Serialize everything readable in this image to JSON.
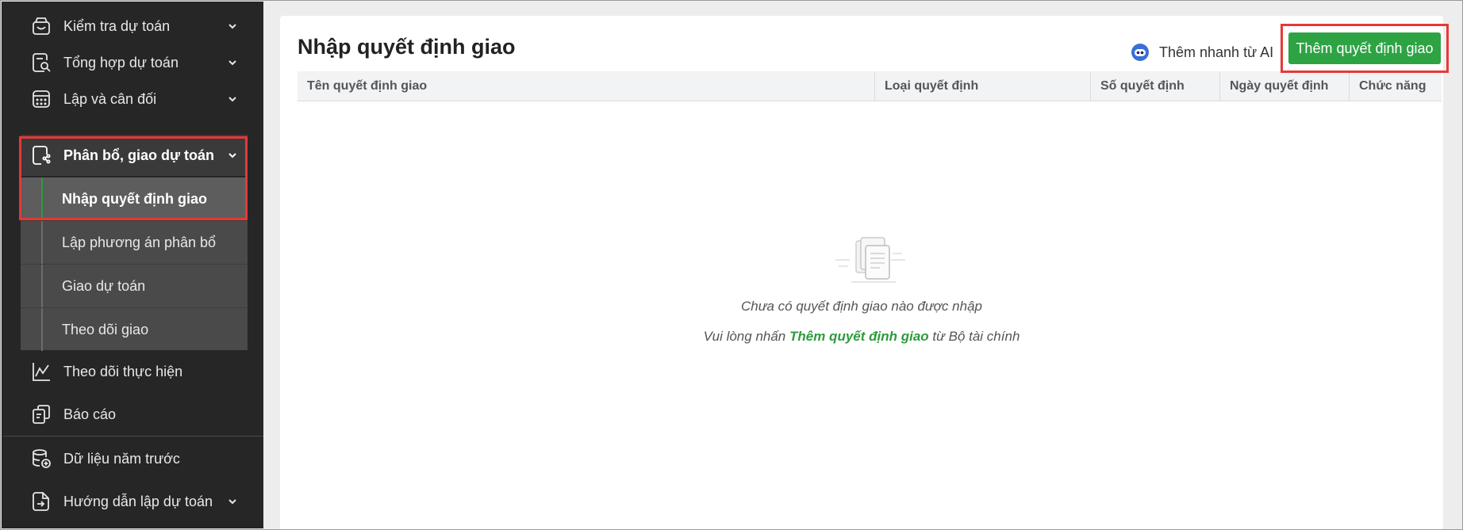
{
  "sidebar": {
    "items": [
      {
        "label": "Kiểm tra dự toán",
        "icon": "inbox-icon"
      },
      {
        "label": "Tổng hợp dự toán",
        "icon": "document-search-icon"
      },
      {
        "label": "Lập và cân đối",
        "icon": "calculator-icon"
      },
      {
        "label": "Phân bổ, giao dự toán",
        "icon": "share-document-icon",
        "active": true
      },
      {
        "label": "Theo dõi thực hiện",
        "icon": "line-chart-icon"
      },
      {
        "label": "Báo cáo",
        "icon": "report-copy-icon"
      },
      {
        "label": "Dữ liệu năm trước",
        "icon": "database-add-icon"
      },
      {
        "label": "Hướng dẫn lập dự toán",
        "icon": "file-export-icon"
      }
    ],
    "sub_items": [
      {
        "label": "Nhập quyết định giao",
        "active": true
      },
      {
        "label": "Lập phương án phân bổ"
      },
      {
        "label": "Giao dự toán"
      },
      {
        "label": "Theo dõi giao"
      }
    ]
  },
  "main": {
    "title": "Nhập quyết định giao",
    "ai_label": "Thêm nhanh từ AI",
    "add_button": "Thêm quyết định giao",
    "columns": [
      "Tên quyết định giao",
      "Loại quyết định",
      "Số quyết định",
      "Ngày quyết định",
      "Chức năng"
    ],
    "empty": {
      "line1": "Chưa có quyết định giao nào được nhập",
      "line2_prefix": "Vui lòng nhấn ",
      "line2_emphasis": "Thêm quyết định giao",
      "line2_suffix": " từ Bộ tài chính"
    }
  },
  "colors": {
    "sidebar_bg": "#262626",
    "accent_green": "#2ea344",
    "highlight_red": "#e53935"
  }
}
